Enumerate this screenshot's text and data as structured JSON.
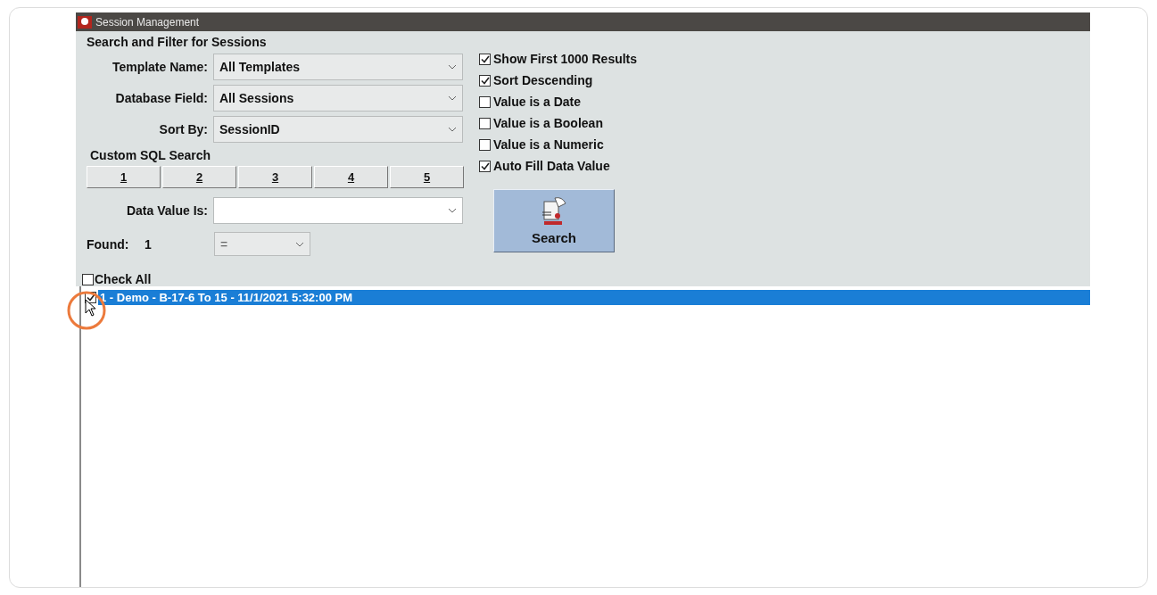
{
  "window": {
    "title": "Session Management"
  },
  "filter": {
    "heading": "Search and Filter for Sessions",
    "fields": [
      {
        "label": "Template Name:",
        "value": "All Templates"
      },
      {
        "label": "Database Field:",
        "value": "All Sessions"
      },
      {
        "label": "Sort By:",
        "value": "SessionID"
      }
    ],
    "custom_sql": {
      "heading": "Custom SQL Search",
      "buttons": [
        "1",
        "2",
        "3",
        "4",
        "5"
      ]
    },
    "data_value": {
      "label": "Data Value Is:"
    },
    "found": {
      "label": "Found:",
      "count": "1",
      "operator": "="
    }
  },
  "options": [
    {
      "label": "Show First 1000 Results",
      "checked": true
    },
    {
      "label": "Sort Descending",
      "checked": true
    },
    {
      "label": "Value is a Date",
      "checked": false
    },
    {
      "label": "Value is a Boolean",
      "checked": false
    },
    {
      "label": "Value is a Numeric",
      "checked": false
    },
    {
      "label": "Auto Fill Data Value",
      "checked": true
    }
  ],
  "search_button": {
    "label": "Search"
  },
  "list": {
    "check_all": {
      "label": "Check All",
      "checked": false
    },
    "rows": [
      {
        "text": "1 - Demo - B-17-6 To 15 - 11/1/2021 5:32:00 PM",
        "checked": true,
        "selected": true
      }
    ]
  }
}
